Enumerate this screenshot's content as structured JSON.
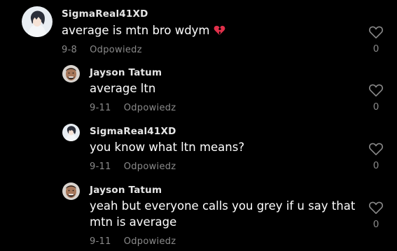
{
  "comments": [
    {
      "username": "SigmaReal41XD",
      "text": "average is mtn bro wdym",
      "emoji_icon": "broken-heart-icon",
      "date": "9-8",
      "reply_label": "Odpowiedz",
      "likes": "0"
    },
    {
      "username": "Jayson Tatum",
      "text": "average ltn",
      "date": "9-11",
      "reply_label": "Odpowiedz",
      "likes": "0"
    },
    {
      "username": "SigmaReal41XD",
      "text": "you know what ltn means?",
      "date": "9-11",
      "reply_label": "Odpowiedz",
      "likes": "0"
    },
    {
      "username": "Jayson Tatum",
      "text_lines": [
        "yeah but everyone calls you grey if u say that",
        "mtn is average"
      ],
      "date": "9-11",
      "reply_label": "Odpowiedz",
      "likes": "0"
    }
  ],
  "colors": {
    "background": "#000000",
    "username": "#e6e6e6",
    "text": "#ffffff",
    "meta": "#8a8a8a",
    "broken_heart": "#e0304a"
  }
}
